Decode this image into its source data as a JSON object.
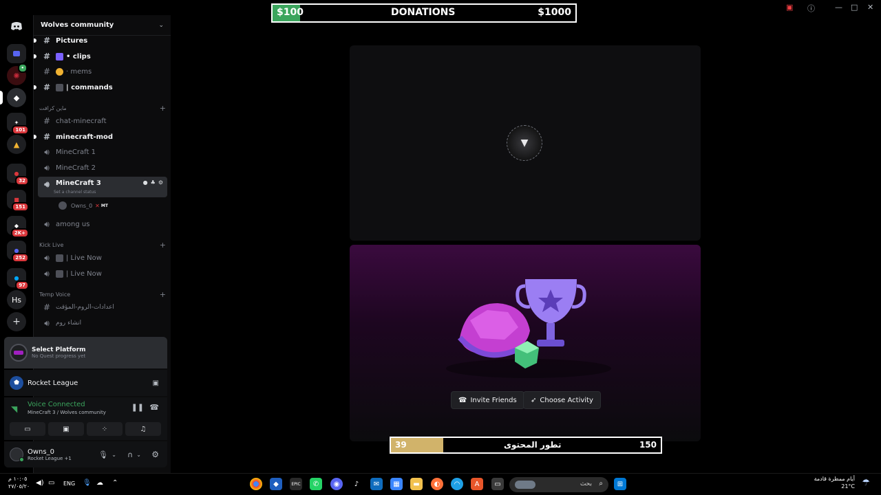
{
  "window": {
    "title": "Wolves community"
  },
  "donation": {
    "min_label": "$100",
    "title": "DONATIONS",
    "max_label": "$1000",
    "progress": 0.09
  },
  "rail": {
    "badges": [
      "101",
      "32",
      "151",
      "2K+",
      "252",
      "97"
    ],
    "hs_label": "Hs"
  },
  "server": {
    "name": "Wolves community"
  },
  "channels": [
    {
      "label": "Pictures",
      "icon": "hash-icon",
      "unread": true
    },
    {
      "label": "• clips",
      "icon": "hash-icon",
      "unread": true
    },
    {
      "label": "· mems",
      "icon": "hash-icon",
      "unread": false
    },
    {
      "label": "| commands",
      "icon": "hash-icon",
      "unread": true
    }
  ],
  "categories": {
    "minecraft": "ماين كرافت",
    "kick_live": "Kick Live",
    "temp_voice": "Temp Voice"
  },
  "mc_channels": [
    {
      "label": "chat-minecraft",
      "icon": "hash-icon",
      "unread": false
    },
    {
      "label": "minecraft-mod",
      "icon": "hash-icon",
      "unread": true
    },
    {
      "label": "MineCraft 1",
      "icon": "speaker-icon",
      "unread": false
    },
    {
      "label": "MineCraft 2",
      "icon": "speaker-icon",
      "unread": false
    },
    {
      "label": "MineCraft 3",
      "icon": "speaker-icon",
      "unread": true
    }
  ],
  "voice_status": "Set a channel status",
  "voice_member": {
    "name": "Owns_0",
    "tag": "MT"
  },
  "among_us": "among us",
  "kick_channels": [
    "| Live Now",
    "| Live Now"
  ],
  "temp_channels": [
    "اعدادات-الروم-المؤقت",
    "انشاء روم"
  ],
  "quest": {
    "title": "Select Platform",
    "subtitle": "No Quest progress yet"
  },
  "game": {
    "name": "Rocket League"
  },
  "voice": {
    "status": "Voice Connected",
    "channel": "MineCraft 3 / Wolves community"
  },
  "user": {
    "name": "Owns_0",
    "activity": "Rocket League +1"
  },
  "activity_buttons": {
    "invite": "Invite Friends",
    "choose": "Choose Activity"
  },
  "content_progress": {
    "left": "39",
    "title": "تطور المحتوى",
    "right": "150",
    "progress": 0.195
  },
  "taskbar": {
    "time": "١٠:٠٥ م",
    "date": "٢٧/٠٥/٢٠",
    "lang": "ENG",
    "search_placeholder": "بحث",
    "weather_text": "أيام ممطرة قادمة",
    "temp": "21°C"
  },
  "colors": {
    "accent_green": "#3ba55d",
    "gold": "#d1b36a",
    "danger": "#da373c"
  }
}
